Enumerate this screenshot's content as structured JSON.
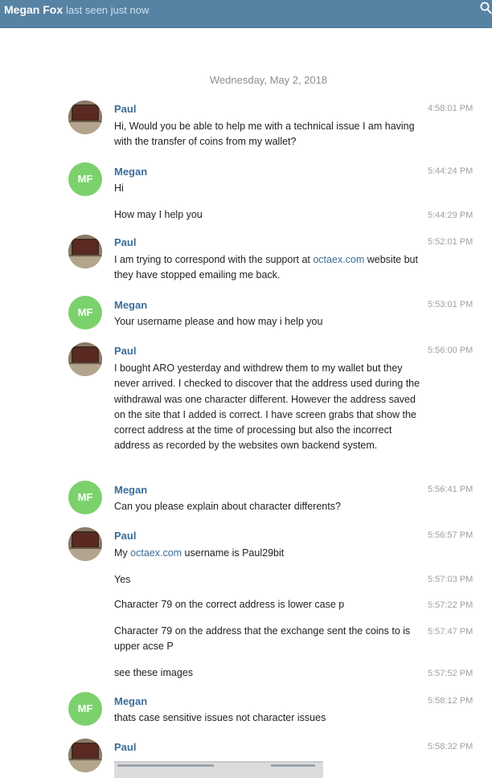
{
  "header": {
    "contact_name": "Megan Fox",
    "status": "last seen just now",
    "search_icon": "search-icon"
  },
  "date_separator": "Wednesday, May 2, 2018",
  "colors": {
    "header_bg": "#5682a3",
    "sender_name": "#3a6d99",
    "link": "#3a6d99",
    "avatar_mf": "#7bd16c"
  },
  "messages": [
    {
      "sender": "Paul",
      "avatar": "photo",
      "time": "4:58:01 PM",
      "text": "Hi, Would you be able to help me with a technical issue I am having with the transfer of coins from my wallet?"
    },
    {
      "sender": "Megan",
      "avatar": "MF",
      "time": "5:44:24 PM",
      "text": "Hi"
    },
    {
      "time": "5:44:29 PM",
      "text": "How may I help you"
    },
    {
      "sender": "Paul",
      "avatar": "photo",
      "time": "5:52:01 PM",
      "text_before": "I am trying to correspond with the support at ",
      "link": "octaex.com",
      "text_after": " website but they have stopped emailing me back."
    },
    {
      "sender": "Megan",
      "avatar": "MF",
      "time": "5:53:01 PM",
      "text": "Your username please and how may i help you"
    },
    {
      "sender": "Paul",
      "avatar": "photo",
      "time": "5:56:00 PM",
      "text": "I bought ARO yesterday and withdrew them to my wallet but they never arrived.  I checked to discover that the address used during the withdrawal was one character different.  However the address saved on the site that I added is correct.  I have screen grabs that show the correct address at the time of processing but also the incorrect address as recorded by the websites own backend system."
    },
    {
      "sender": "Megan",
      "avatar": "MF",
      "time": "5:56:41 PM",
      "text": "Can you please explain about character differents?"
    },
    {
      "sender": "Paul",
      "avatar": "photo",
      "time": "5:56:57 PM",
      "text_before": "My ",
      "link": "octaex.com",
      "text_after": " username is Paul29bit"
    },
    {
      "time": "5:57:03 PM",
      "text": "Yes"
    },
    {
      "time": "5:57:22 PM",
      "text": "Character 79 on the correct address is lower case p"
    },
    {
      "time": "5:57:47 PM",
      "text": "Character 79 on the address that the exchange sent the coins to is upper acse P"
    },
    {
      "time": "5:57:52 PM",
      "text": "see these images"
    },
    {
      "sender": "Megan",
      "avatar": "MF",
      "time": "5:58:12 PM",
      "text": "thats case sensitive issues not character issues"
    },
    {
      "sender": "Paul",
      "avatar": "photo",
      "time": "5:58:32 PM"
    }
  ]
}
